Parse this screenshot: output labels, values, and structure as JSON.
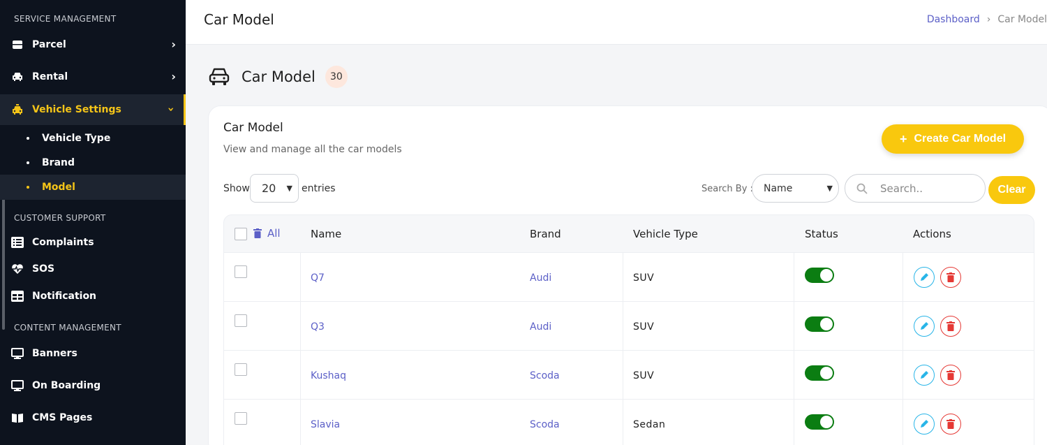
{
  "sidebar": {
    "sections": {
      "service": "SERVICE MANAGEMENT",
      "support": "CUSTOMER SUPPORT",
      "content": "CONTENT MANAGEMENT"
    },
    "items": {
      "parcel": "Parcel",
      "rental": "Rental",
      "vehicle_settings": "Vehicle Settings",
      "vehicle_type": "Vehicle Type",
      "brand": "Brand",
      "model": "Model",
      "complaints": "Complaints",
      "sos": "SOS",
      "notification": "Notification",
      "banners": "Banners",
      "onboarding": "On Boarding",
      "cms_pages": "CMS Pages"
    }
  },
  "header": {
    "title": "Car Model",
    "breadcrumb": {
      "home": "Dashboard",
      "current": "Car Model"
    }
  },
  "content": {
    "title": "Car Model",
    "count": "30"
  },
  "card": {
    "title": "Car Model",
    "subtitle": "View and manage all the car models",
    "create_label": "Create Car Model",
    "show_label": "Show",
    "show_value": "20",
    "entries_label": "entries",
    "search_by_label": "Search By :",
    "search_by_value": "Name",
    "search_placeholder": "Search..",
    "clear_label": "Clear"
  },
  "table": {
    "headers": {
      "all": "All",
      "name": "Name",
      "brand": "Brand",
      "vehicle_type": "Vehicle Type",
      "status": "Status",
      "actions": "Actions"
    },
    "rows": [
      {
        "name": "Q7",
        "brand": "Audi",
        "type": "SUV",
        "status": "active"
      },
      {
        "name": "Q3",
        "brand": "Audi",
        "type": "SUV",
        "status": "active"
      },
      {
        "name": "Kushaq",
        "brand": "Scoda",
        "type": "SUV",
        "status": "active"
      },
      {
        "name": "Slavia",
        "brand": "Scoda",
        "type": "Sedan",
        "status": "active"
      }
    ]
  },
  "colors": {
    "accent": "#f9c80e",
    "sidebar_bg": "#0d131e",
    "link": "#5b5fc7",
    "toggle_on": "#0b7d12",
    "edit": "#28b5e8",
    "delete": "#e53935"
  }
}
